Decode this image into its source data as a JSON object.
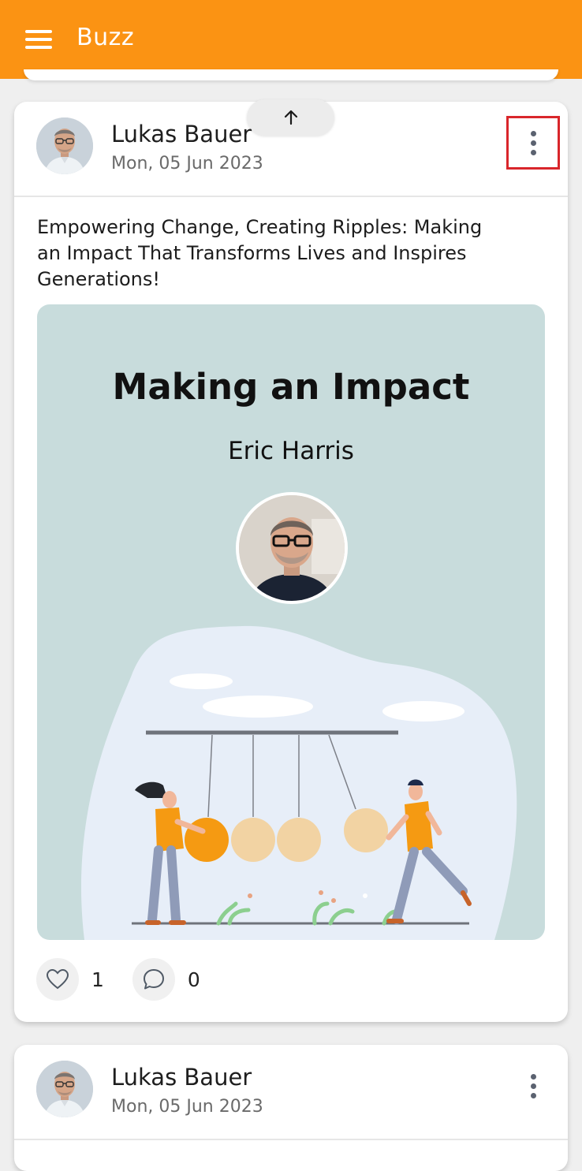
{
  "app": {
    "title": "Buzz"
  },
  "colors": {
    "accent": "#fb9313",
    "highlight": "#d9262b"
  },
  "icons": {
    "menu": "hamburger-menu-icon",
    "more": "more-vertical-icon",
    "scroll_top": "arrow-up-icon",
    "like": "heart-icon",
    "comment": "comment-bubble-icon"
  },
  "posts": [
    {
      "author": "Lukas Bauer",
      "date": "Mon, 05 Jun 2023",
      "text": "Empowering Change, Creating Ripples: Making an Impact That Transforms Lives and Inspires Generations!",
      "image": {
        "title": "Making an Impact",
        "subtitle": "Eric Harris"
      },
      "likes": "1",
      "comments": "0"
    },
    {
      "author": "Lukas Bauer",
      "date": "Mon, 05 Jun 2023"
    }
  ]
}
